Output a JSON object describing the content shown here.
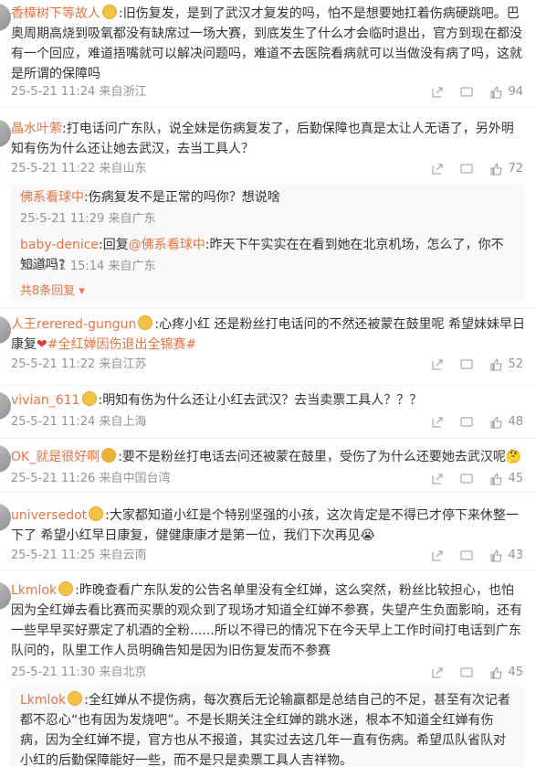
{
  "comments": [
    {
      "user": "香樟树下等故人",
      "text": ":旧伤复发，是到了武汉才复发的吗，怕不是想要她扛着伤病硬跳吧。巴奥周期高烧到吸氧都没有缺席过一场大赛，到底发生了什么才会临时退出，官方到现在都没有一个回应，难道捂嘴就可以解决问题吗，难道不去医院看病就可以当做没有病了吗，这就是所谓的保障吗",
      "meta": "25-5-21 11:24 来自浙江",
      "likes": "94"
    },
    {
      "user": "晶水叶萦",
      "text": ":打电话问广东队，说全妹是伤病复发了，后勤保障也真是太让人无语了，另外明知有伤为什么还让她去武汉，去当工具人？",
      "meta": "25-5-21 11:22 来自山东",
      "likes": "72",
      "replies": [
        {
          "user": "佛系看球中",
          "text": ":伤病复发不是正常的吗你？想说啥",
          "meta": "25-5-21 11:29 来自广东"
        },
        {
          "user": "baby-denice",
          "prefix": ":回复",
          "mention": "@佛系看球中",
          "text": ":昨天下午实实在在看到她在北京机场，怎么了，你不知道吗?",
          "meta": "25-5-21 15:14 来自广东"
        }
      ],
      "more": "共8条回复"
    },
    {
      "user": "人王rerered-gungun",
      "text": ":心疼小红 还是粉丝打电话问的不然还被蒙在鼓里呢 希望妹妹早日康复",
      "tag": "#全红婵因伤退出全锦赛#",
      "meta": "25-5-21 11:22 来自江苏",
      "likes": "52"
    },
    {
      "user": "vivian_611",
      "text": ":明知有伤为什么还让小红去武汉？去当卖票工具人？？？",
      "meta": "25-5-21 11:24 来自上海",
      "likes": "48"
    },
    {
      "user": "OK_就是很好啊",
      "text": ":要不是粉丝打电话去问还被蒙在鼓里，受伤了为什么还要她去武汉呢",
      "meta": "25-5-21 11:26 来自中国台湾",
      "likes": "45"
    },
    {
      "user": "universedot",
      "text": ":大家都知道小红是个特别坚强的小孩，这次肯定是不得已才停下来休整一下了 希望小红早日康复，健健康康才是第一位，我们下次再见",
      "meta": "25-5-21 11:25 来自云南",
      "likes": "43"
    },
    {
      "user": "Lkmlok",
      "text": ":昨晚查看广东队发的公告名单里没有全红婵，这么突然，粉丝比较担心，也怕因为全红婵去看比赛而买票的观众到了现场才知道全红婵不参赛，失望产生负面影响，还有一些早早买好票定了机酒的全粉......所以不得已的情况下在今天早上工作时间打电话到广东队问的，队里工作人员明确告知是因为旧伤复发而不参赛",
      "meta": "25-5-21 11:30 来自北京",
      "likes": "45",
      "replies": [
        {
          "user": "Lkmlok",
          "text": ":全红婵从不提伤病，每次赛后无论输赢都是总结自己的不足，甚至有次记者都不忍心“也有因为发烧吧”。不是长期关注全红婵的跳水迷，根本不知道全红婵有伤病，因为全红婵不提，官方也从不报道，其实过去这几年一直有伤病。希望瓜队省队对小红的后勤保障能好一些，而不是只是卖票工具人吉祥物。"
        }
      ]
    }
  ],
  "colors": {
    "accent": "#eb7340",
    "meta": "#939393"
  }
}
